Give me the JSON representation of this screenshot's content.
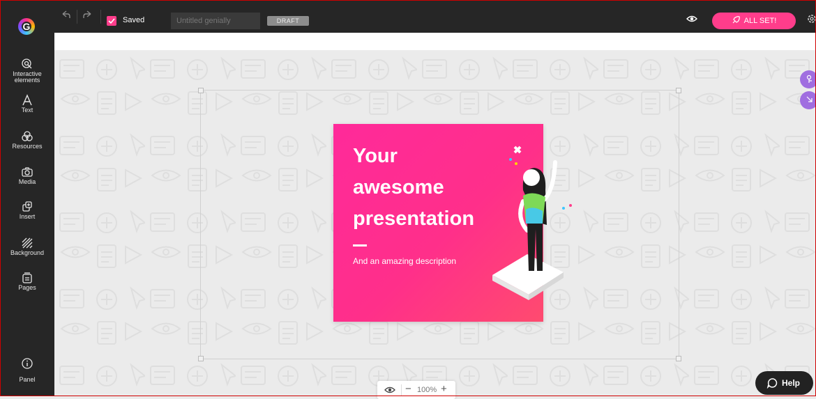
{
  "topbar": {
    "saved_label": "Saved",
    "title_placeholder": "Untitled genially",
    "draft_badge": "DRAFT",
    "publish_label": "ALL SET!"
  },
  "sidebar": {
    "items": [
      {
        "label_line1": "Interactive",
        "label_line2": "elements",
        "icon": "interactive-icon"
      },
      {
        "label": "Text",
        "icon": "text-icon"
      },
      {
        "label": "Resources",
        "icon": "resources-icon"
      },
      {
        "label": "Media",
        "icon": "camera-icon"
      },
      {
        "label": "Insert",
        "icon": "insert-icon"
      },
      {
        "label": "Background",
        "icon": "background-icon"
      },
      {
        "label": "Pages",
        "icon": "pages-icon"
      }
    ],
    "panel_label": "Panel"
  },
  "slide": {
    "title_line1": "Your",
    "title_line2": "awesome",
    "title_line3": "presentation",
    "description": "And an amazing description"
  },
  "zoom": {
    "level": "100%",
    "minus": "−",
    "plus": "+"
  },
  "help": {
    "label": "Help"
  },
  "colors": {
    "accent": "#ff3d8b",
    "topbar": "#262626",
    "bubble": "#a06ee0"
  }
}
